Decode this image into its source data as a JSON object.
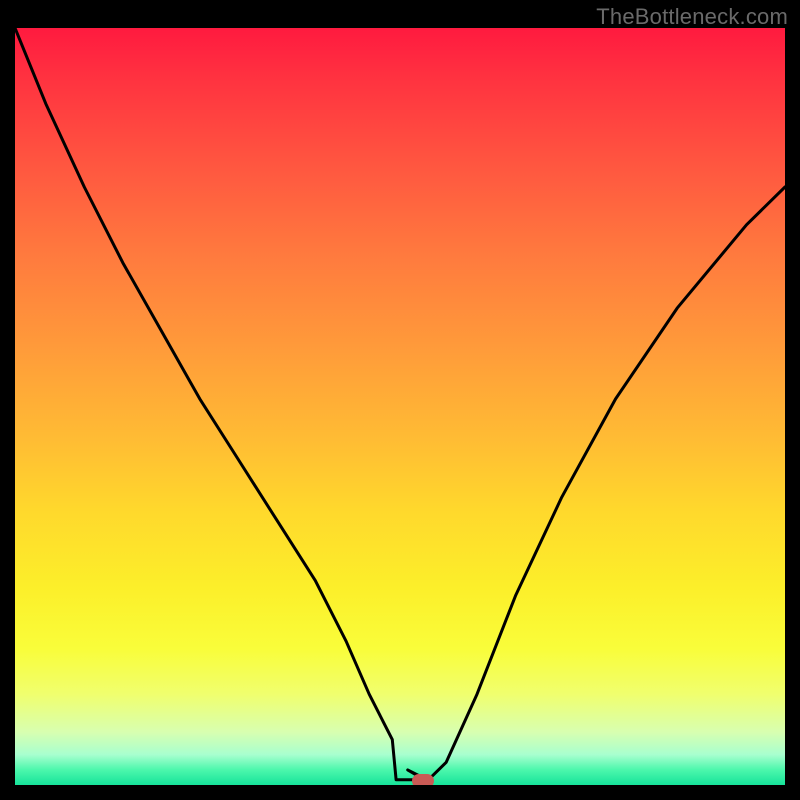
{
  "watermark": "TheBottleneck.com",
  "colors": {
    "frame": "#000000",
    "marker": "#c95a55",
    "curve": "#000000",
    "gradient_top": "#ff1a3f",
    "gradient_bottom": "#16e39a"
  },
  "chart_data": {
    "type": "line",
    "title": "",
    "xlabel": "",
    "ylabel": "",
    "xlim": [
      0,
      100
    ],
    "ylim": [
      0,
      100
    ],
    "grid": false,
    "legend": false,
    "note": "V-shaped bottleneck curve over a vertical heat gradient. Axis tick labels are not shown; x/y values are in percent of plot width/height with y=0 at bottom.",
    "series": [
      {
        "name": "bottleneck-curve",
        "x": [
          0,
          4,
          9,
          14,
          19,
          24,
          29,
          34,
          39,
          43,
          46,
          49,
          51,
          53.5,
          56,
          60,
          65,
          71,
          78,
          86,
          95,
          100
        ],
        "y": [
          100,
          90,
          79,
          69,
          60,
          51,
          43,
          35,
          27,
          19,
          12,
          6,
          2,
          0.5,
          3,
          12,
          25,
          38,
          51,
          63,
          74,
          79
        ]
      }
    ],
    "marker": {
      "x": 53,
      "y": 0.5,
      "label": "optimal-point"
    },
    "flat_bottom": {
      "x_start": 49.5,
      "x_end": 53.5,
      "y": 0.7
    }
  }
}
